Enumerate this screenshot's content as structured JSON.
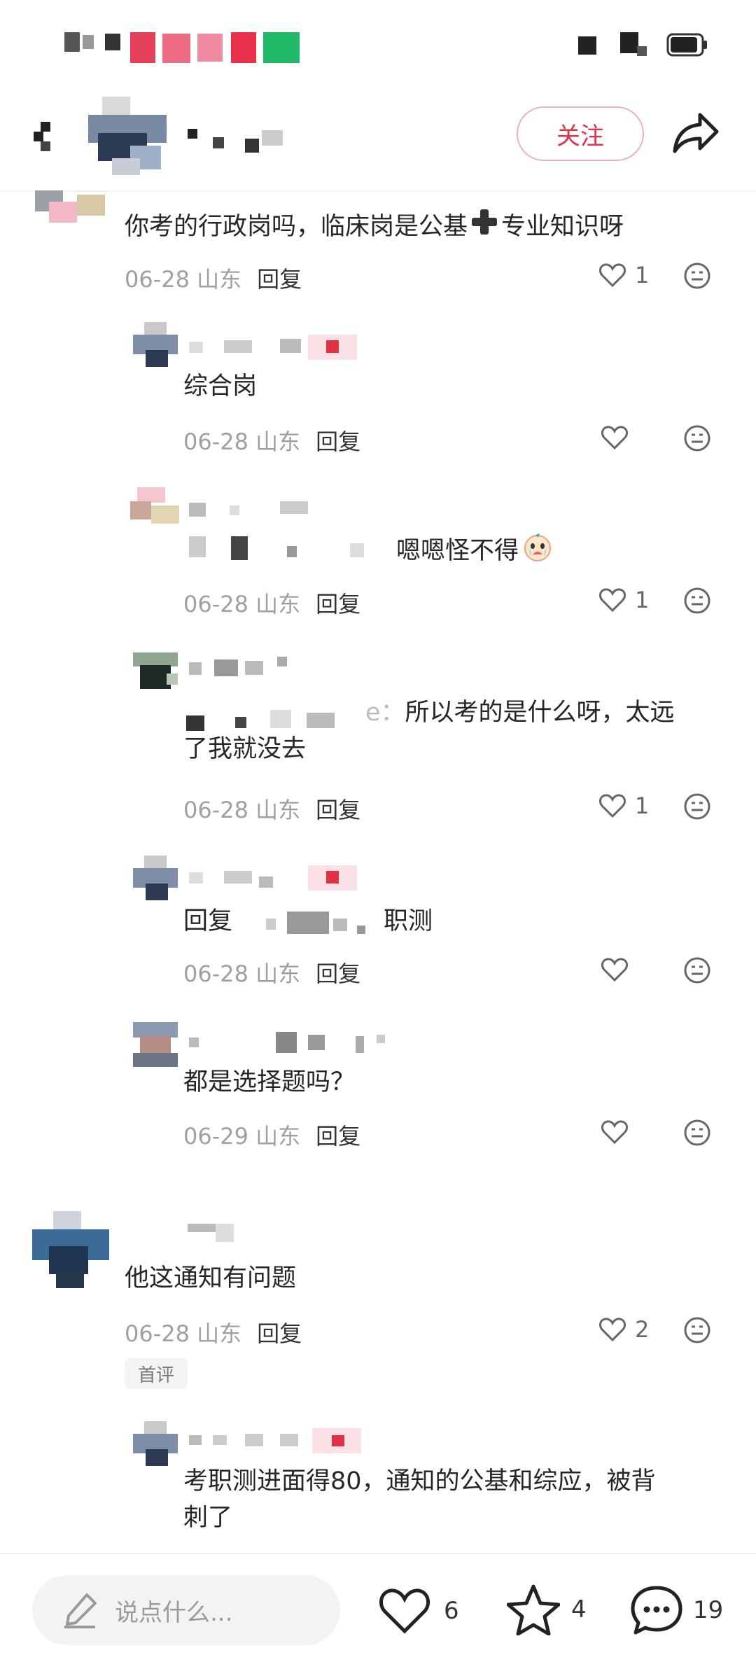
{
  "header": {
    "follow_label": "关注"
  },
  "comments": [
    {
      "text": "你考的行政岗吗，临床岗是公基",
      "text_tail": "专业知识呀",
      "date": "06-28",
      "region": "山东",
      "reply": "回复",
      "likes": "1"
    },
    {
      "text": "综合岗",
      "date": "06-28",
      "region": "山东",
      "reply": "回复",
      "likes": ""
    },
    {
      "text": "嗯嗯怪不得",
      "date": "06-28",
      "region": "山东",
      "reply": "回复",
      "likes": "1"
    },
    {
      "text": "所以考的是什么呀，太远",
      "text_line2": "了我就没去",
      "prefix_tail": "e：",
      "date": "06-28",
      "region": "山东",
      "reply": "回复",
      "likes": "1"
    },
    {
      "text_prefix": "回复",
      "text": "职测",
      "date": "06-28",
      "region": "山东",
      "reply": "回复",
      "likes": ""
    },
    {
      "text": "都是选择题吗？",
      "date": "06-29",
      "region": "山东",
      "reply": "回复",
      "likes": ""
    },
    {
      "text": "他这通知有问题",
      "date": "06-28",
      "region": "山东",
      "reply": "回复",
      "likes": "2",
      "badge": "首评"
    },
    {
      "text": "考职测进面得80，通知的公基和综应，被背",
      "text_line2": "刺了"
    }
  ],
  "bottom": {
    "input_placeholder": "说点什么...",
    "like_count": "6",
    "star_count": "4",
    "comment_count": "19"
  },
  "colors": {
    "accent": "#e03346",
    "meta": "#a0a0a0"
  },
  "icons": [
    "heart-icon",
    "emoji-icon",
    "share-icon",
    "back-icon",
    "pencil-icon",
    "star-icon",
    "chat-icon",
    "battery-icon"
  ]
}
